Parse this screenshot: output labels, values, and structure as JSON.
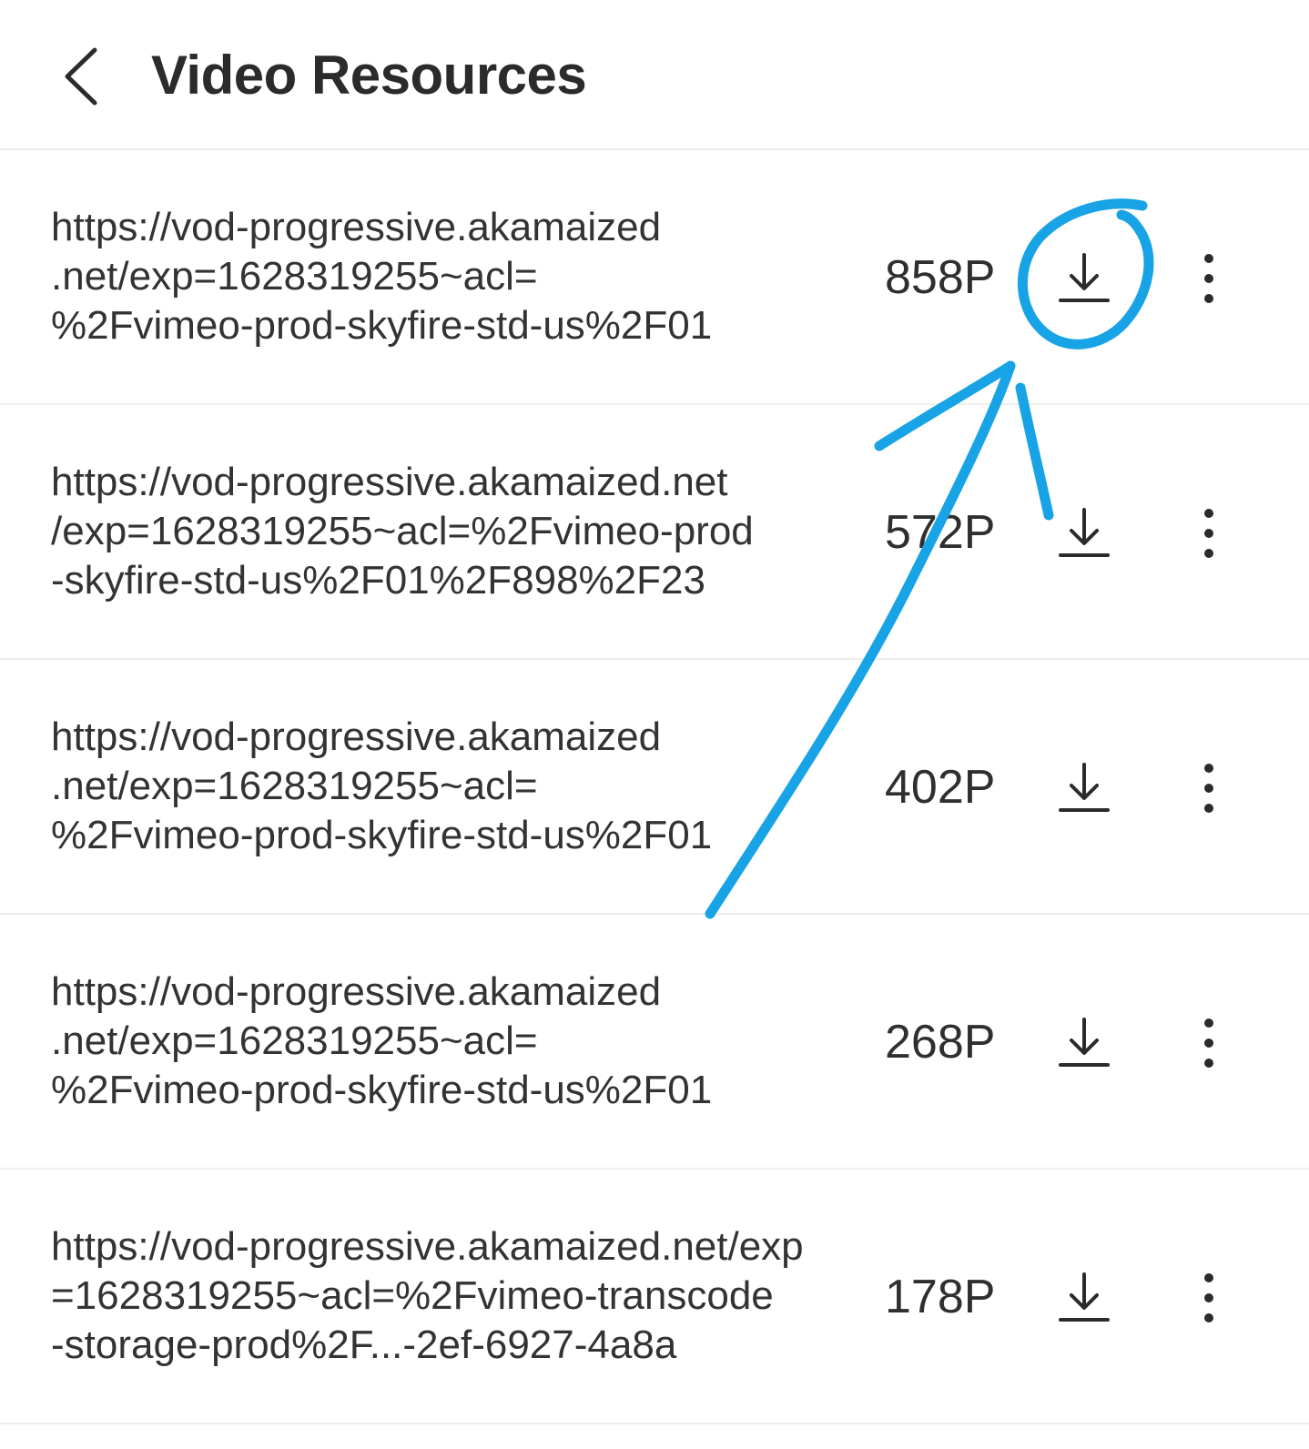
{
  "header": {
    "title": "Video Resources",
    "back_icon": "chevron-left-icon"
  },
  "rows": [
    {
      "url": "https://vod-progressive.akamaized\n.net/exp=1628319255~acl=\n%2Fvimeo-prod-skyfire-std-us%2F01",
      "resolution": "858P"
    },
    {
      "url": "https://vod-progressive.akamaized.net\n/exp=1628319255~acl=%2Fvimeo-prod\n-skyfire-std-us%2F01%2F898%2F23",
      "resolution": "572P"
    },
    {
      "url": "https://vod-progressive.akamaized\n.net/exp=1628319255~acl=\n%2Fvimeo-prod-skyfire-std-us%2F01",
      "resolution": "402P"
    },
    {
      "url": "https://vod-progressive.akamaized\n.net/exp=1628319255~acl=\n%2Fvimeo-prod-skyfire-std-us%2F01",
      "resolution": "268P"
    },
    {
      "url": "https://vod-progressive.akamaized.net/exp\n=1628319255~acl=%2Fvimeo-transcode\n-storage-prod%2F...-2ef-6927-4a8a",
      "resolution": "178P"
    }
  ],
  "icons": {
    "download": "download-icon",
    "more": "more-vertical-icon"
  },
  "colors": {
    "annotation": "#17a3e6",
    "text": "#2a2a2a",
    "divider": "#eeeeee"
  }
}
